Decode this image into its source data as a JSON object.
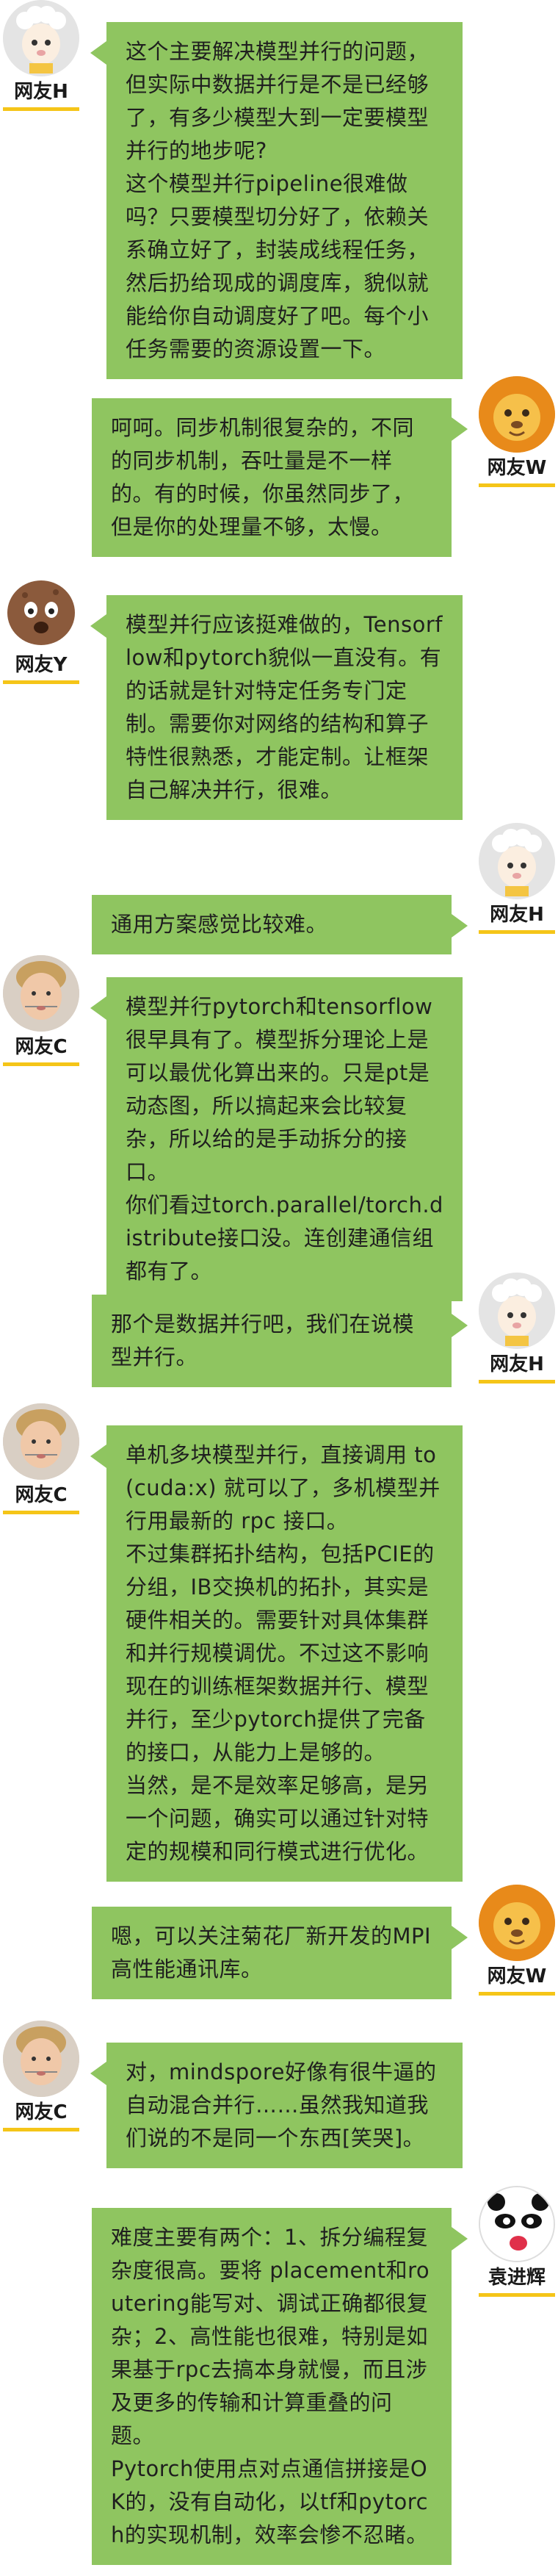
{
  "colors": {
    "bubble": "#8fc560",
    "name_underline": "#f5c518",
    "background": "#ffffff"
  },
  "messages": [
    {
      "side": "left",
      "author": "网友H",
      "avatar": "sheep-avatar-icon",
      "text": "这个主要解决模型并行的问题，但实际中数据并行是不是已经够了，有多少模型大到一定要模型并行的地步呢?\n这个模型并行pipeline很难做吗？只要模型切分好了，依赖关系确立好了，封装成线程任务，然后扔给现成的调度库，貌似就能给你自动调度好了吧。每个小任务需要的资源设置一下。"
    },
    {
      "side": "right",
      "author": "网友W",
      "avatar": "lion-avatar-icon",
      "text": "呵呵。同步机制很复杂的，不同的同步机制，吞吐量是不一样的。有的时候，你虽然同步了，但是你的处理量不够，太慢。"
    },
    {
      "side": "left",
      "author": "网友Y",
      "avatar": "potato-avatar-icon",
      "text": "模型并行应该挺难做的，Tensorflow和pytorch貌似一直没有。有的话就是针对特定任务专门定制。需要你对网络的结构和算子特性很熟悉，才能定制。让框架自己解决并行，很难。"
    },
    {
      "side": "right",
      "author": "网友H",
      "avatar": "sheep-avatar-icon",
      "text": "通用方案感觉比较难。"
    },
    {
      "side": "left",
      "author": "网友C",
      "avatar": "boy-avatar-icon",
      "text": "模型并行pytorch和tensorflow很早具有了。模型拆分理论上是可以最优化算出来的。只是pt是动态图，所以搞起来会比较复杂，所以给的是手动拆分的接口。\n你们看过torch.parallel/torch.distribute接口没。连创建通信组都有了。"
    },
    {
      "side": "right",
      "author": "网友H",
      "avatar": "sheep-avatar-icon",
      "text": "那个是数据并行吧，我们在说模型并行。"
    },
    {
      "side": "left",
      "author": "网友C",
      "avatar": "boy-avatar-icon",
      "text": "单机多块模型并行，直接调用 to(cuda:x) 就可以了，多机模型并行用最新的 rpc 接口。\n不过集群拓扑结构，包括PCIE的分组，IB交换机的拓扑，其实是硬件相关的。需要针对具体集群和并行规模调优。不过这不影响现在的训练框架数据并行、模型并行，至少pytorch提供了完备的接口，从能力上是够的。\n当然，是不是效率足够高，是另一个问题，确实可以通过针对特定的规模和同行模式进行优化。"
    },
    {
      "side": "right",
      "author": "网友W",
      "avatar": "lion-avatar-icon",
      "text": "嗯，可以关注菊花厂新开发的MPI高性能通讯库。"
    },
    {
      "side": "left",
      "author": "网友C",
      "avatar": "boy-avatar-icon",
      "text": "对，mindspore好像有很牛逼的自动混合并行……虽然我知道我们说的不是同一个东西[笑哭]。"
    },
    {
      "side": "right",
      "author": "袁进辉",
      "avatar": "panda-avatar-icon",
      "text": "难度主要有两个：1、拆分编程复杂度很高。要将 placement和routering能写对、调试正确都很复杂；2、高性能也很难，特别是如果基于rpc去搞本身就慢，而且涉及更多的传输和计算重叠的问题。\nPytorch使用点对点通信拼接是OK的，没有自动化，以tf和pytorch的实现机制，效率会惨不忍睹。"
    }
  ]
}
